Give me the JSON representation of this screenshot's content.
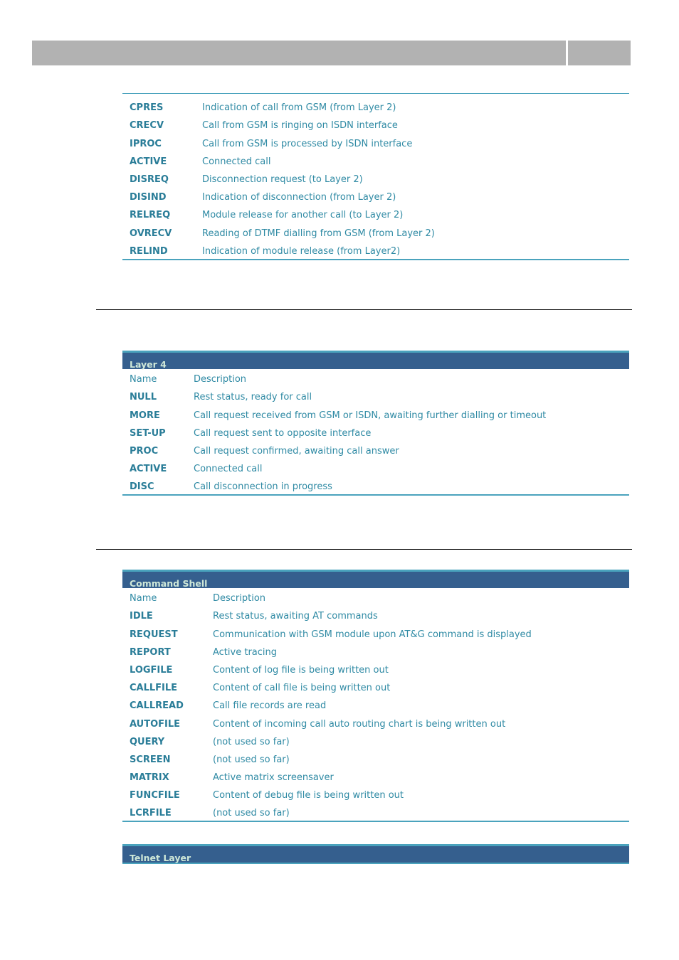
{
  "header": {
    "title": "",
    "page": ""
  },
  "table1": {
    "rows": [
      {
        "name": "CPRES",
        "desc": "Indication of call from GSM (from Layer 2)"
      },
      {
        "name": "CRECV",
        "desc": "Call from GSM is ringing on ISDN interface"
      },
      {
        "name": "IPROC",
        "desc": "Call from GSM is processed by ISDN interface"
      },
      {
        "name": "ACTIVE",
        "desc": "Connected call"
      },
      {
        "name": "DISREQ",
        "desc": "Disconnection request (to Layer 2)"
      },
      {
        "name": "DISIND",
        "desc": "Indication of disconnection (from Layer 2)"
      },
      {
        "name": "RELREQ",
        "desc": "Module release for another call (to Layer 2)"
      },
      {
        "name": "OVRECV",
        "desc": "Reading of DTMF dialling from GSM (from Layer 2)"
      },
      {
        "name": "RELIND",
        "desc": "Indication of module release (from Layer2)"
      }
    ]
  },
  "table2": {
    "caption": "Layer 4",
    "col_name": "Name",
    "col_desc": "Description",
    "rows": [
      {
        "name": "NULL",
        "desc": "Rest status, ready for call"
      },
      {
        "name": "MORE",
        "desc": "Call request received from GSM or ISDN, awaiting further dialling or timeout"
      },
      {
        "name": "SET-UP",
        "desc": "Call request sent to opposite interface"
      },
      {
        "name": "PROC",
        "desc": "Call request confirmed, awaiting call answer"
      },
      {
        "name": "ACTIVE",
        "desc": "Connected call"
      },
      {
        "name": "DISC",
        "desc": "Call disconnection in progress"
      }
    ]
  },
  "table3": {
    "caption": "Command Shell",
    "col_name": "Name",
    "col_desc": "Description",
    "rows": [
      {
        "name": "IDLE",
        "desc": "Rest status, awaiting AT commands"
      },
      {
        "name": "REQUEST",
        "desc": "Communication with GSM module upon AT&G command is displayed"
      },
      {
        "name": "REPORT",
        "desc": "Active tracing"
      },
      {
        "name": "LOGFILE",
        "desc": "Content of log file is being written out"
      },
      {
        "name": "CALLFILE",
        "desc": "Content of call file is being written out"
      },
      {
        "name": "CALLREAD",
        "desc": "Call file records are read"
      },
      {
        "name": "AUTOFILE",
        "desc": "Content of incoming call auto routing chart is being written out"
      },
      {
        "name": "QUERY",
        "desc": "(not used so far)"
      },
      {
        "name": "SCREEN",
        "desc": "(not used so far)"
      },
      {
        "name": "MATRIX",
        "desc": "Active matrix screensaver"
      },
      {
        "name": "FUNCFILE",
        "desc": "Content of debug file is being written out"
      },
      {
        "name": "LCRFILE",
        "desc": "(not used so far)"
      }
    ]
  },
  "table4": {
    "caption": "Telnet Layer"
  }
}
